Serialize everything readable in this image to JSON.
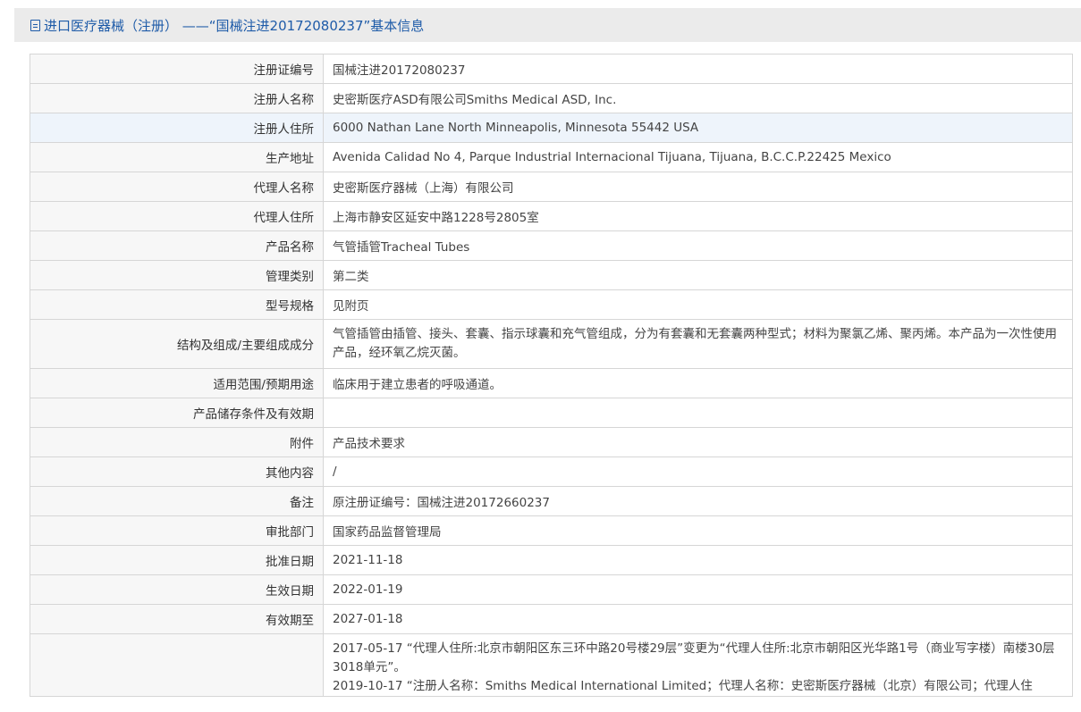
{
  "header": {
    "title": "进口医疗器械（注册） ——“国械注进20172080237”基本信息"
  },
  "rows": [
    {
      "label": "注册证编号",
      "value": "国械注进20172080237"
    },
    {
      "label": "注册人名称",
      "value": "史密斯医疗ASD有限公司Smiths Medical ASD, Inc."
    },
    {
      "label": "注册人住所",
      "value": "6000 Nathan Lane North Minneapolis, Minnesota 55442 USA"
    },
    {
      "label": "生产地址",
      "value": "Avenida Calidad No 4, Parque Industrial Internacional Tijuana, Tijuana, B.C.C.P.22425 Mexico"
    },
    {
      "label": "代理人名称",
      "value": "史密斯医疗器械（上海）有限公司"
    },
    {
      "label": "代理人住所",
      "value": "上海市静安区延安中路1228号2805室"
    },
    {
      "label": "产品名称",
      "value": "气管插管Tracheal Tubes"
    },
    {
      "label": "管理类别",
      "value": "第二类"
    },
    {
      "label": "型号规格",
      "value": "见附页"
    },
    {
      "label": "结构及组成/主要组成成分",
      "value": "气管插管由插管、接头、套囊、指示球囊和充气管组成，分为有套囊和无套囊两种型式；材料为聚氯乙烯、聚丙烯。本产品为一次性使用产品，经环氧乙烷灭菌。"
    },
    {
      "label": "适用范围/预期用途",
      "value": "临床用于建立患者的呼吸通道。"
    },
    {
      "label": "产品储存条件及有效期",
      "value": ""
    },
    {
      "label": "附件",
      "value": "产品技术要求"
    },
    {
      "label": "其他内容",
      "value": "/"
    },
    {
      "label": "备注",
      "value": "原注册证编号：国械注进20172660237"
    },
    {
      "label": "审批部门",
      "value": "国家药品监督管理局"
    },
    {
      "label": "批准日期",
      "value": "2021-11-18"
    },
    {
      "label": "生效日期",
      "value": "2022-01-19"
    },
    {
      "label": "有效期至",
      "value": "2027-01-18"
    }
  ],
  "changes": {
    "label": "",
    "entries": [
      "2017-05-17 “代理人住所:北京市朝阳区东三环中路20号楼29层”变更为“代理人住所:北京市朝阳区光华路1号（商业写字楼）南楼30层3018单元”。",
      "2019-10-17 “注册人名称：Smiths Medical International Limited；代理人名称：史密斯医疗器械（北京）有限公司；代理人住"
    ]
  }
}
